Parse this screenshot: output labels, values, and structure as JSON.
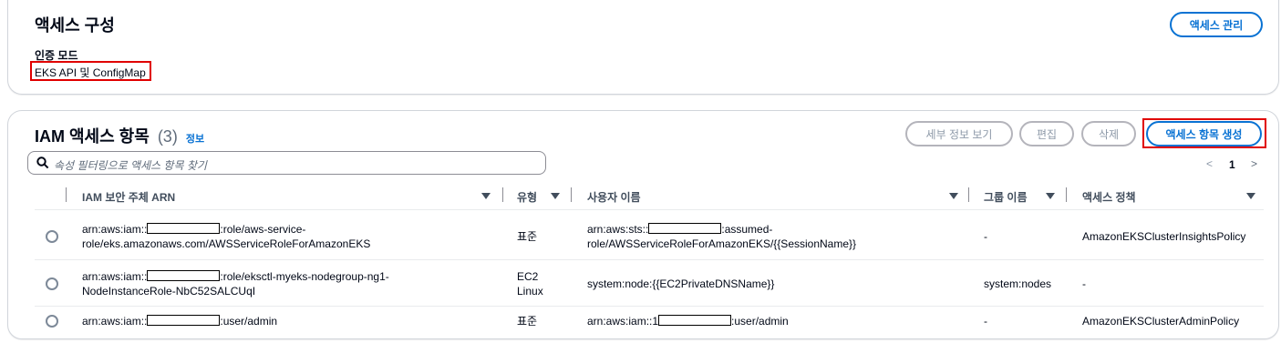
{
  "access_config": {
    "title": "액세스 구성",
    "manage_button": "액세스 관리",
    "auth_mode_label": "인증 모드",
    "auth_mode_value": "EKS API 및 ConfigMap"
  },
  "entries": {
    "title": "IAM 액세스 항목",
    "count": "(3)",
    "info_link": "정보",
    "buttons": {
      "details": "세부 정보 보기",
      "edit": "편집",
      "delete": "삭제",
      "create": "액세스 항목 생성"
    },
    "search_placeholder": "속성 필터링으로 액세스 항목 찾기",
    "pagination": {
      "prev": "<",
      "page": "1",
      "next": ">"
    },
    "columns": [
      "IAM 보안 주체 ARN",
      "유형",
      "사용자 이름",
      "그룹 이름",
      "액세스 정책"
    ],
    "rows": [
      {
        "arn_line1_pre": "arn:aws:iam::",
        "arn_line1_post": ":role/aws-service-",
        "arn_line2": "role/eks.amazonaws.com/AWSServiceRoleForAmazonEKS",
        "type": "표준",
        "user_line1_pre": "arn:aws:sts::",
        "user_line1_post": ":assumed-",
        "user_line2": "role/AWSServiceRoleForAmazonEKS/{{SessionName}}",
        "group": "-",
        "policy": "AmazonEKSClusterInsightsPolicy"
      },
      {
        "arn_line1_pre": "arn:aws:iam::",
        "arn_line1_post": ":role/eksctl-myeks-nodegroup-ng1-",
        "arn_line2": "NodeInstanceRole-NbC52SALCUqI",
        "type_line1": "EC2",
        "type_line2": "Linux",
        "user": "system:node:{{EC2PrivateDNSName}}",
        "group": "system:nodes",
        "policy": "-"
      },
      {
        "arn_line1_pre": "arn:aws:iam::",
        "arn_line1_post": ":user/admin",
        "type": "표준",
        "user_pre": "arn:aws:iam::1",
        "user_post": ":user/admin",
        "group": "-",
        "policy": "AmazonEKSClusterAdminPolicy"
      }
    ]
  },
  "colors": {
    "link": "#0972d3",
    "highlight": "#e00000",
    "text": "#000716"
  }
}
